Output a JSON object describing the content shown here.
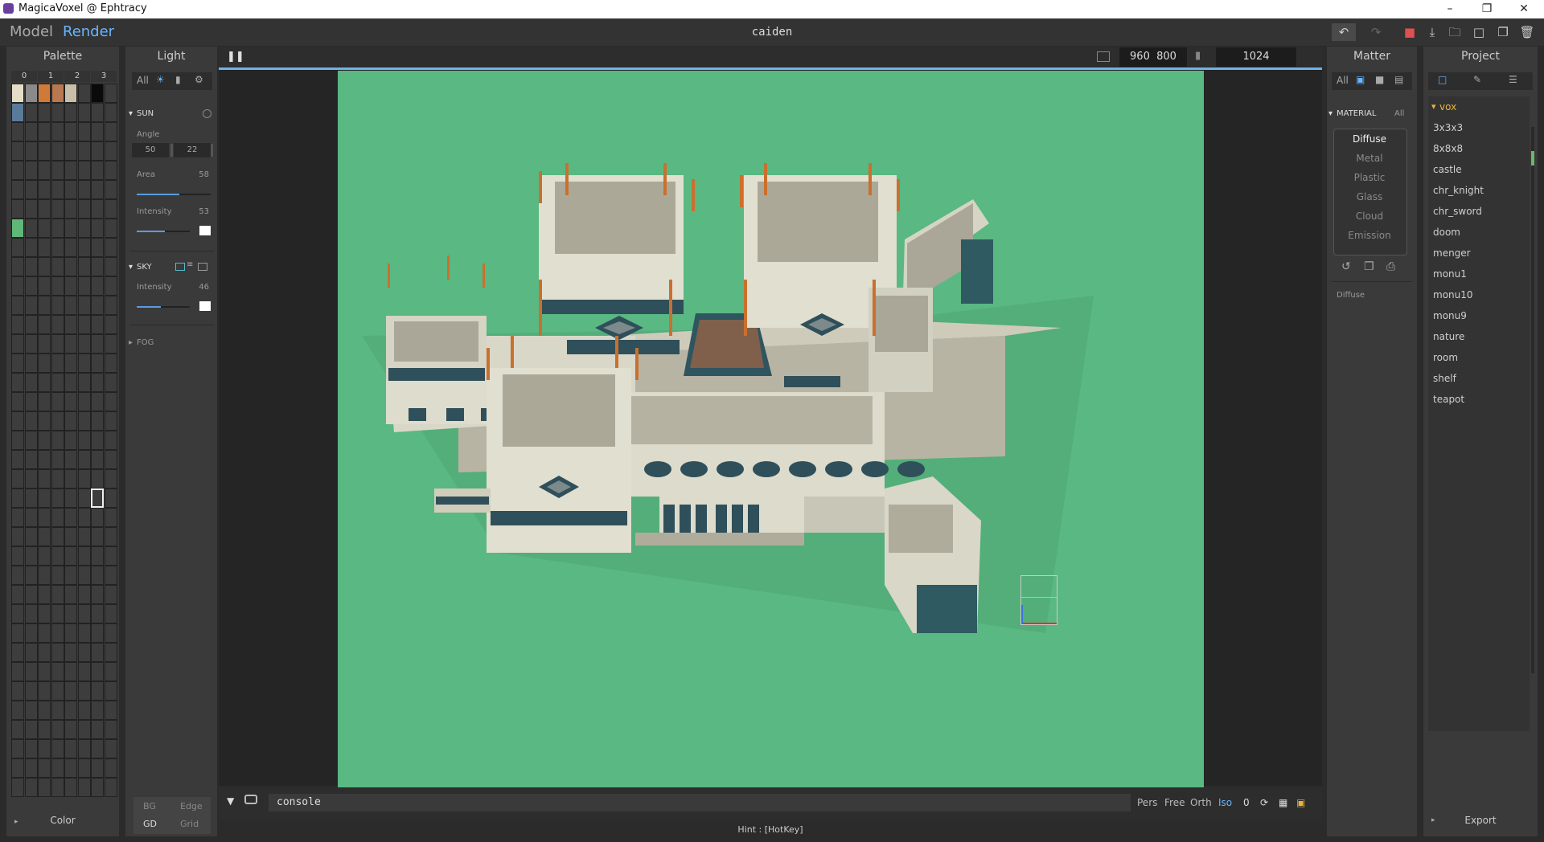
{
  "window": {
    "title": "MagicaVoxel @ Ephtracy"
  },
  "header": {
    "modes": [
      "Model",
      "Render"
    ],
    "active_mode": "Render",
    "doc_title": "caiden"
  },
  "palette": {
    "title": "Palette",
    "tabs": [
      "0",
      "1",
      "2",
      "3"
    ],
    "footer": "Color",
    "colors": {
      "cream": "#e6ddc8",
      "tan": "#c8a27a",
      "orange": "#d07a3a",
      "brown": "#b87850",
      "beige": "#c9bfa8",
      "black": "#0a0a0a",
      "blue": "#5a7a9a",
      "green": "#5fb877"
    }
  },
  "light": {
    "title": "Light",
    "tabs": [
      "All"
    ],
    "sun": {
      "title": "SUN",
      "angle_label": "Angle",
      "angle1": "50",
      "angle2": "22",
      "area_label": "Area",
      "area_value": "58",
      "intensity_label": "Intensity",
      "intensity_value": "53"
    },
    "sky": {
      "title": "SKY",
      "intensity_label": "Intensity",
      "intensity_value": "46"
    },
    "fog": {
      "title": "FOG"
    },
    "footer": {
      "bg": "BG",
      "edge": "Edge",
      "gd": "GD",
      "grid": "Grid"
    }
  },
  "viewport": {
    "size_w": "960",
    "size_h": "800",
    "samples": "1024"
  },
  "console": {
    "placeholder": "console",
    "modes": [
      "Pers",
      "Free",
      "Orth",
      "Iso"
    ],
    "active_mode": "Iso",
    "counter": "0"
  },
  "hint": "Hint : [HotKey]",
  "matter": {
    "title": "Matter",
    "tabs": [
      "All"
    ],
    "section": "MATERIAL",
    "section_filter": "All",
    "materials": [
      "Diffuse",
      "Metal",
      "Plastic",
      "Glass",
      "Cloud",
      "Emission"
    ],
    "active": "Diffuse",
    "current": "Diffuse"
  },
  "project": {
    "title": "Project",
    "folder": "vox",
    "items": [
      "3x3x3",
      "8x8x8",
      "castle",
      "chr_knight",
      "chr_sword",
      "doom",
      "menger",
      "monu1",
      "monu10",
      "monu9",
      "nature",
      "room",
      "shelf",
      "teapot"
    ],
    "footer": "Export"
  },
  "colors": {
    "render_bg": "#5ab882",
    "accent_blue": "#6fb2e8",
    "iso_active": "#6ab4ff"
  }
}
